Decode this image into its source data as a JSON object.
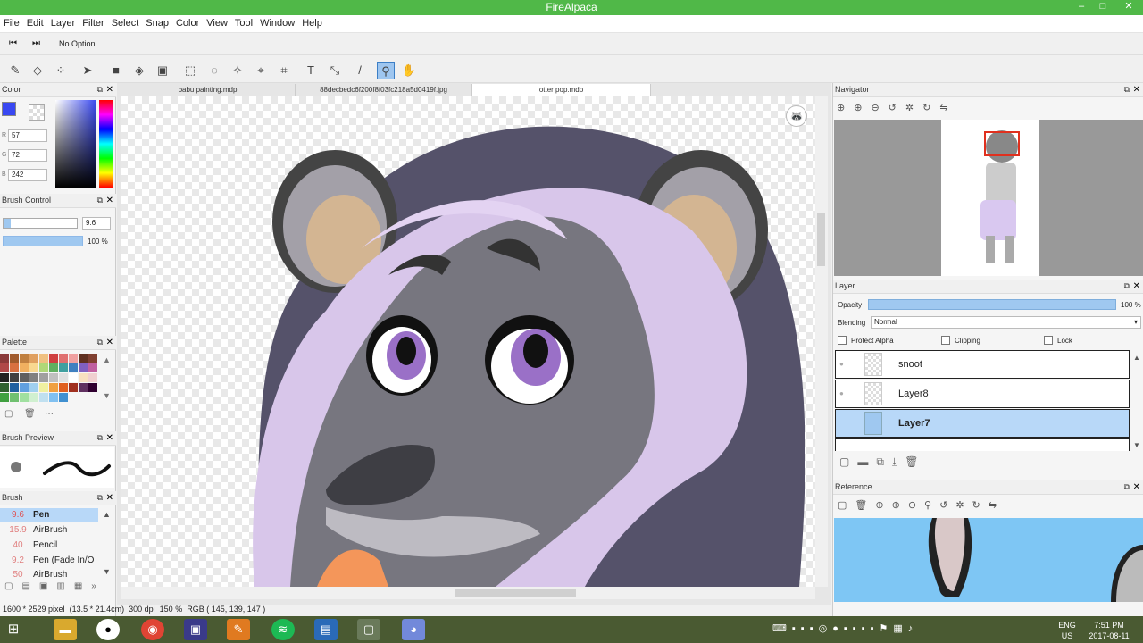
{
  "window": {
    "title": "FireAlpaca",
    "minimize": "–",
    "maximize": "□",
    "close": "✕"
  },
  "menu": [
    "File",
    "Edit",
    "Layer",
    "Filter",
    "Select",
    "Snap",
    "Color",
    "View",
    "Tool",
    "Window",
    "Help"
  ],
  "options": {
    "label": "No Option"
  },
  "tabs": [
    {
      "label": "babu painting.mdp"
    },
    {
      "label": "88decbedc6f200f8f03fc218a5d0419f.jpg"
    },
    {
      "label": "otter pop.mdp"
    }
  ],
  "color_panel": {
    "title": "Color",
    "r_label": "R",
    "r": "57",
    "g_label": "G",
    "g": "72",
    "b_label": "B",
    "b": "242",
    "primary": "#3948f2"
  },
  "brush_control": {
    "title": "Brush Control",
    "size": "9.6",
    "opacity": "100 %"
  },
  "palette": {
    "title": "Palette",
    "more": "···"
  },
  "brush_preview": {
    "title": "Brush Preview"
  },
  "brush_panel": {
    "title": "Brush",
    "items": [
      {
        "size": "9.6",
        "name": "Pen"
      },
      {
        "size": "15.9",
        "name": "AirBrush"
      },
      {
        "size": "40",
        "name": "Pencil"
      },
      {
        "size": "9.2",
        "name": "Pen (Fade In/O"
      },
      {
        "size": "50",
        "name": "AirBrush"
      }
    ]
  },
  "navigator": {
    "title": "Navigator"
  },
  "layer_panel": {
    "title": "Layer",
    "opacity_label": "Opacity",
    "opacity_value": "100 %",
    "blending_label": "Blending",
    "blending_value": "Normal",
    "protect_alpha": "Protect Alpha",
    "clipping": "Clipping",
    "lock": "Lock",
    "layers": [
      {
        "name": "snoot"
      },
      {
        "name": "Layer8"
      },
      {
        "name": "Layer7"
      }
    ]
  },
  "reference": {
    "title": "Reference"
  },
  "status": {
    "size": "1600 * 2529 pixel",
    "cm": "(13.5 * 21.4cm)",
    "dpi": "300 dpi",
    "zoom": "150 %",
    "rgb": "RGB ( 145, 139, 147 )"
  },
  "taskbar": {
    "lang1": "ENG",
    "lang2": "US",
    "time": "7:51 PM",
    "date": "2017-08-11"
  }
}
